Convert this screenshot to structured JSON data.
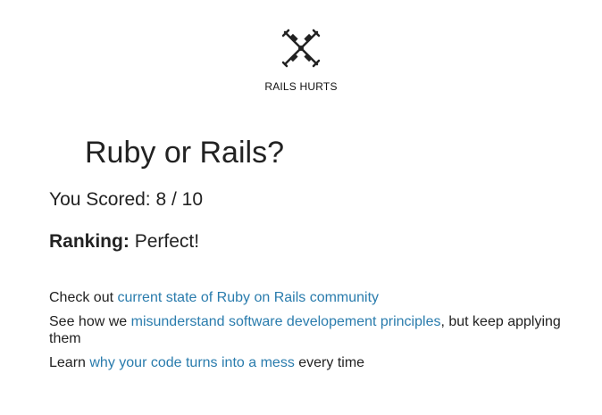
{
  "header": {
    "logo_icon": "crossed-crutches-icon",
    "brand_name": "RAILS HURTS"
  },
  "quiz": {
    "title": "Ruby or Rails?",
    "score_text": "You Scored: 8 / 10",
    "score": 8,
    "score_max": 10,
    "ranking_label": "Ranking:",
    "ranking_value": "Perfect!"
  },
  "links": [
    {
      "before": "Check out ",
      "link_text": "current state of Ruby on Rails community",
      "after": ""
    },
    {
      "before": "See how we ",
      "link_text": "misunderstand software developement principles",
      "after": ", but keep applying them"
    },
    {
      "before": "Learn ",
      "link_text": "why your code turns into a mess",
      "after": " every time"
    }
  ],
  "colors": {
    "text": "#222222",
    "link": "#2a7cad",
    "background": "#ffffff"
  }
}
